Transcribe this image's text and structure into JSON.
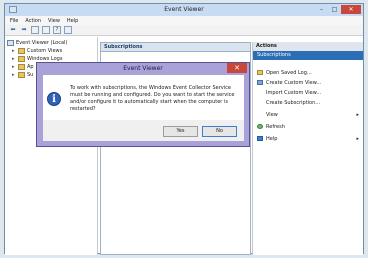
{
  "window": {
    "title": "Event Viewer",
    "minimize": "–",
    "maximize": "□",
    "close": "✕"
  },
  "menu": [
    "File",
    "Action",
    "View",
    "Help"
  ],
  "toolbar": {
    "help_label": "?",
    "back": "⬅",
    "forward": "➡"
  },
  "tree": {
    "root": "Event Viewer (Local)",
    "items": [
      "Custom Views",
      "Windows Logs",
      "Ap",
      "Su"
    ]
  },
  "center": {
    "header": "Subscriptions"
  },
  "actions": {
    "header": "Actions",
    "section": "Subscriptions",
    "items": [
      {
        "label": "Open Saved Log..."
      },
      {
        "label": "Create Custom View..."
      },
      {
        "label": "Import Custom View..."
      },
      {
        "label": "Create Subscription..."
      },
      {
        "label": "View",
        "arrow": "▸"
      },
      {
        "label": "Refresh"
      },
      {
        "label": "Help",
        "arrow": "▸"
      }
    ]
  },
  "dialog": {
    "title": "Event Viewer",
    "close": "✕",
    "icon_glyph": "i",
    "message": "To work with subscriptions, the Windows Event Collector Service must be running and configured.  Do you want to start the service and/or configure it to automatically start when the computer is restarted?",
    "yes_label": "Yes",
    "no_label": "No"
  },
  "colors": {
    "accent": "#2c6eb5",
    "dialog_frame": "#a8a2d8",
    "close_red": "#c8473b"
  }
}
